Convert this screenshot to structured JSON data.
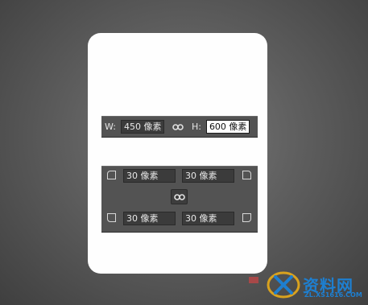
{
  "dimensions": {
    "w_label": "W:",
    "w_value": "450 像素",
    "h_label": "H:",
    "h_value": "600 像素"
  },
  "corner_radii": {
    "top_left": "30 像素",
    "top_right": "30 像素",
    "bottom_left": "30 像素",
    "bottom_right": "30 像素"
  },
  "watermark": {
    "text": "资料网",
    "url": "ZL.XS1616.COM"
  },
  "icons": {
    "link": "link-icon",
    "corner_tl": "corner-top-left-icon",
    "corner_tr": "corner-top-right-icon",
    "corner_bl": "corner-bottom-left-icon",
    "corner_br": "corner-bottom-right-icon"
  },
  "colors": {
    "panel": "#535353",
    "field_dark": "#3b3b3b",
    "field_light": "#ffffff",
    "watermark": "#1e7fd0"
  }
}
